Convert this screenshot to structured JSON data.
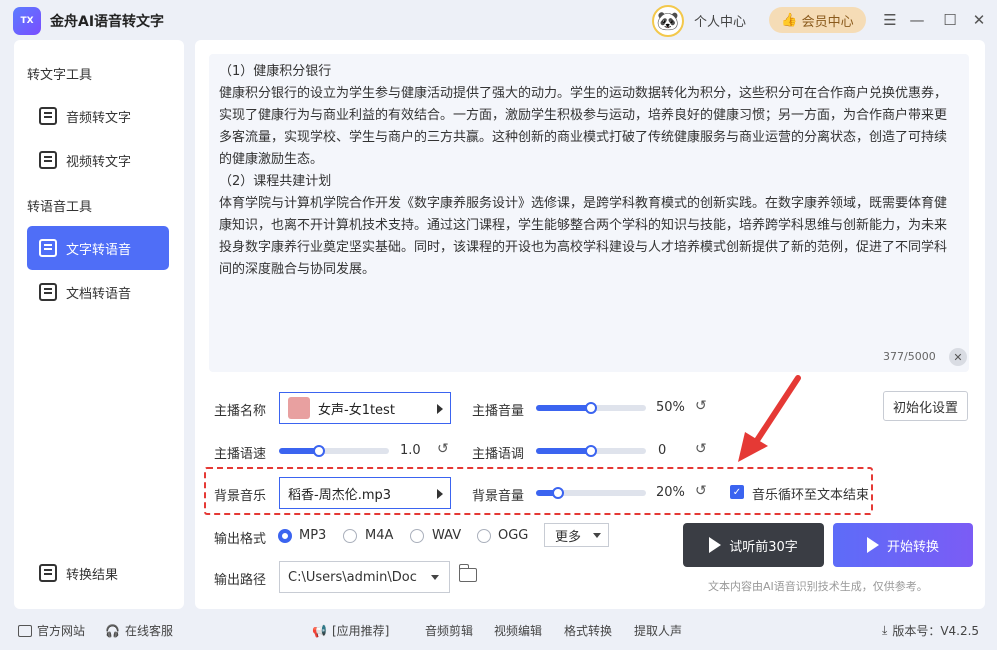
{
  "app": {
    "title": "金舟AI语音转文字",
    "logo_text": "TX"
  },
  "header": {
    "personal_center": "个人中心",
    "vip_center": "会员中心"
  },
  "sidebar": {
    "section1": "转文字工具",
    "items1": [
      {
        "label": "音频转文字"
      },
      {
        "label": "视频转文字"
      }
    ],
    "section2": "转语音工具",
    "items2": [
      {
        "label": "文字转语音"
      },
      {
        "label": "文档转语音"
      }
    ],
    "result": "转换结果"
  },
  "editor": {
    "paragraphs": [
      "（1）健康积分银行",
      "健康积分银行的设立为学生参与健康活动提供了强大的动力。学生的运动数据转化为积分，这些积分可在合作商户兑换优惠券，实现了健康行为与商业利益的有效结合。一方面，激励学生积极参与运动，培养良好的健康习惯；另一方面，为合作商户带来更多客流量，实现学校、学生与商户的三方共赢。这种创新的商业模式打破了传统健康服务与商业运营的分离状态，创造了可持续的健康激励生态。",
      "（2）课程共建计划",
      "体育学院与计算机学院合作开发《数字康养服务设计》选修课，是跨学科教育模式的创新实践。在数字康养领域，既需要体育健康知识，也离不开计算机技术支持。通过这门课程，学生能够整合两个学科的知识与技能，培养跨学科思维与创新能力，为未来投身数字康养行业奠定坚实基础。同时，该课程的开设也为高校学科建设与人才培养模式创新提供了新的范例，促进了不同学科间的深度融合与协同发展。"
    ],
    "counter": "377/5000"
  },
  "settings": {
    "anchor_label": "主播名称",
    "anchor_value": "女声-女1test",
    "volume_label": "主播音量",
    "volume_value": "50%",
    "volume_pct": 50,
    "init_button": "初始化设置",
    "speed_label": "主播语速",
    "speed_value": "1.0",
    "speed_pct": 36,
    "pitch_label": "主播语调",
    "pitch_value": "0",
    "pitch_pct": 50,
    "bgm_label": "背景音乐",
    "bgm_value": "稻香-周杰伦.mp3",
    "bgm_volume_label": "背景音量",
    "bgm_volume_value": "20%",
    "bgm_volume_pct": 20,
    "loop_label": "音乐循环至文本结束",
    "loop_checked": true,
    "format_label": "输出格式",
    "formats": [
      "MP3",
      "M4A",
      "WAV",
      "OGG"
    ],
    "format_selected": "MP3",
    "more_label": "更多",
    "path_label": "输出路径",
    "path_value": "C:\\Users\\admin\\Doc"
  },
  "actions": {
    "preview": "试听前30字",
    "start": "开始转换",
    "disclaimer": "文本内容由AI语音识别技术生成，仅供参考。"
  },
  "footer": {
    "website": "官方网站",
    "service": "在线客服",
    "recommend": "[应用推荐]",
    "links": [
      "音频剪辑",
      "视频编辑",
      "格式转换",
      "提取人声"
    ],
    "version": "版本号：V4.2.5"
  },
  "colors": {
    "accent": "#4f6ef7",
    "highlight": "#e53935"
  }
}
